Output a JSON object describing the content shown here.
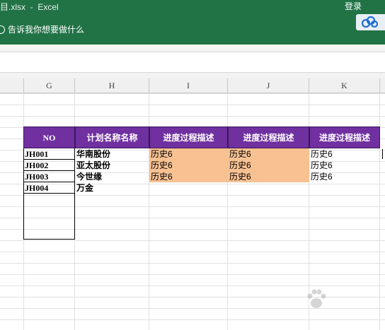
{
  "window": {
    "title": "目.xlsx  -  Excel",
    "login_label": "登录",
    "tell_me": "告诉我你想要做什么"
  },
  "columns": [
    "G",
    "H",
    "I",
    "J",
    "K"
  ],
  "table": {
    "headers": [
      "NO",
      "计划名称名称",
      "进度过程描述",
      "进度过程描述",
      "进度过程描述"
    ],
    "rows": [
      {
        "no": "JH001",
        "name": "华南股份",
        "i": "历史6",
        "j": "历史6",
        "k": "历史6"
      },
      {
        "no": "JH002",
        "name": "亚太股份",
        "i": "历史6",
        "j": "历史6",
        "k": "历史6"
      },
      {
        "no": "JH003",
        "name": "今世缘",
        "i": "历史6",
        "j": "历史6",
        "k": "历史6"
      },
      {
        "no": "JH004",
        "name": "万金",
        "i": "",
        "j": "",
        "k": ""
      }
    ]
  },
  "colors": {
    "title_bar": "#217346",
    "header_fill": "#7030a0",
    "highlight_fill": "#f8c192"
  }
}
